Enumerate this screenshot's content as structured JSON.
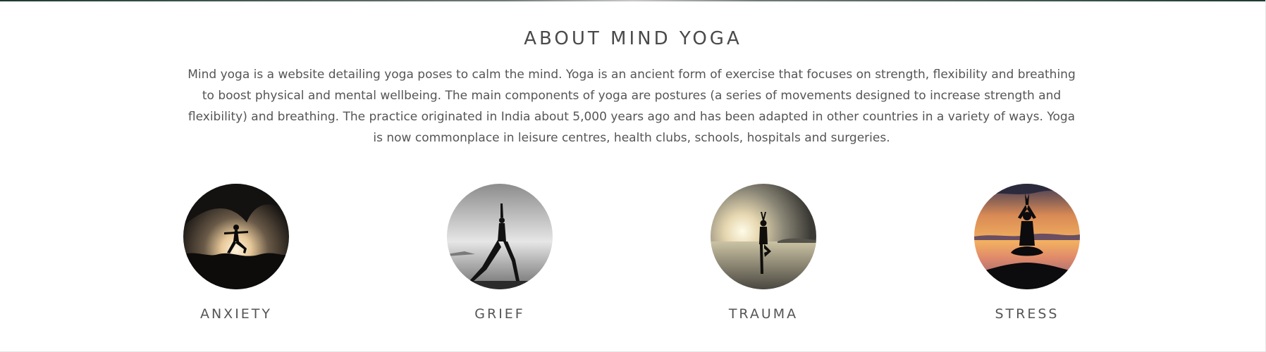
{
  "about": {
    "title": "ABOUT MIND YOGA",
    "text": "Mind yoga is a website detailing yoga poses to calm the mind. Yoga is an ancient form of exercise that focuses on strength, flexibility and breathing to boost physical and mental wellbeing. The main components of yoga are postures (a series of movements designed to increase strength and flexibility) and breathing. The practice originated in India about 5,000 years ago and has been adapted in other countries in a variety of ways. Yoga is now commonplace in leisure centres, health clubs, schools, hospitals and surgeries."
  },
  "categories": [
    {
      "label": "ANXIETY",
      "image": "silhouette-warrior-pose-cave-sunset"
    },
    {
      "label": "GRIEF",
      "image": "silhouette-lunge-pose-grayscale-sea"
    },
    {
      "label": "TRAUMA",
      "image": "silhouette-tree-pose-beach-sunset"
    },
    {
      "label": "STRESS",
      "image": "silhouette-lotus-pose-orange-sunset"
    }
  ],
  "colors": {
    "text": "#555555",
    "heading": "#4a4a4a",
    "background": "#ffffff"
  }
}
